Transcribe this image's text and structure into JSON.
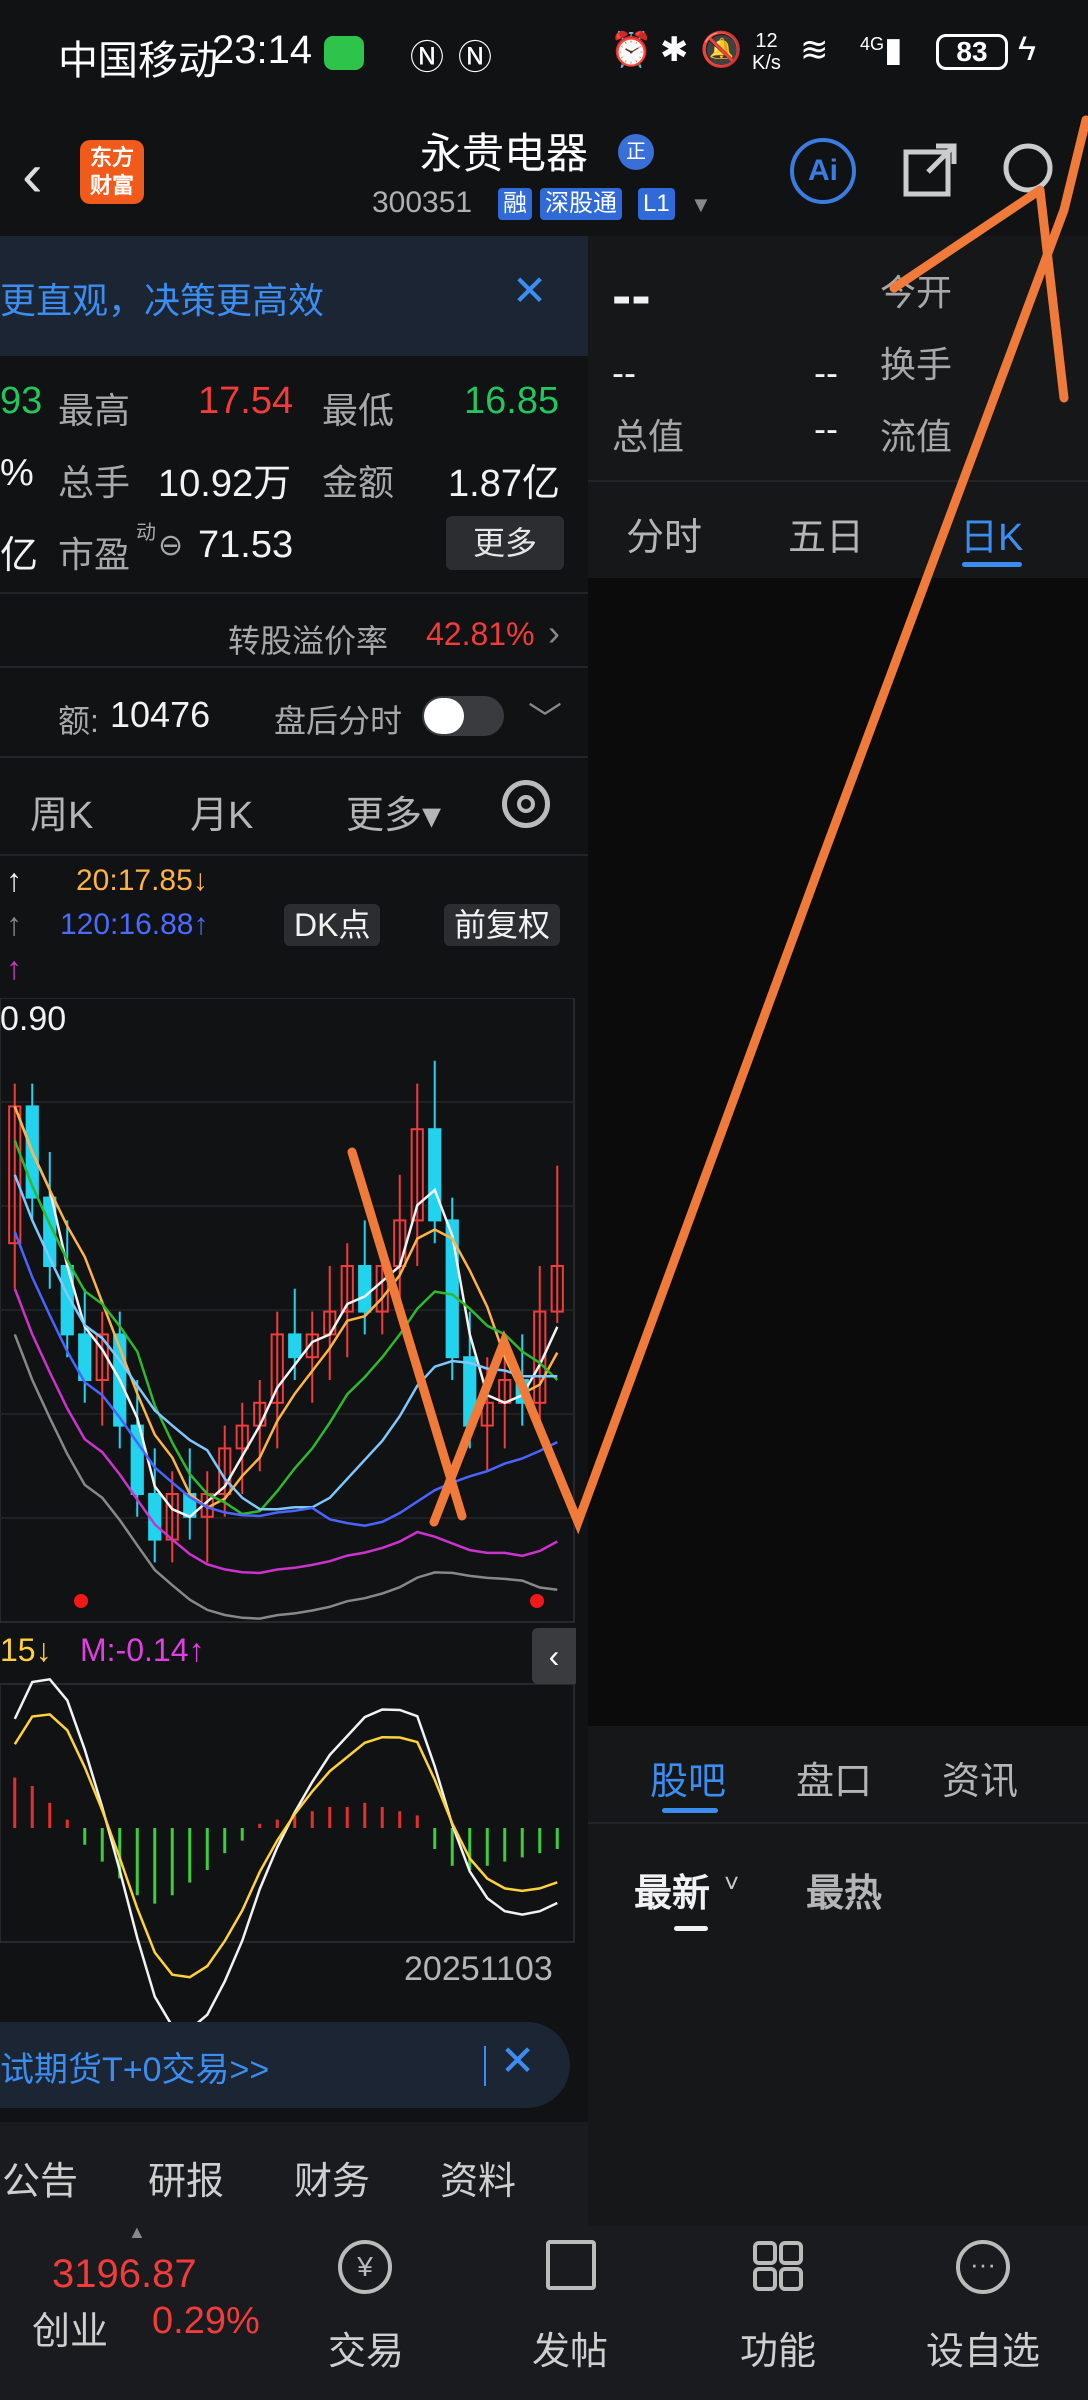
{
  "status_bar": {
    "carrier": "中国移动",
    "time": "23:14",
    "net_speed_top": "12",
    "net_speed_bottom": "K/s",
    "network": "4G",
    "battery": "83"
  },
  "header": {
    "title": "永贵电器",
    "title_badge": "正",
    "code": "300351",
    "tags": [
      "融",
      "深股通",
      "L1"
    ],
    "logo_line1": "东方",
    "logo_line2": "财富",
    "ai_label": "Ai"
  },
  "banner": {
    "text": "更直观，决策更高效"
  },
  "quotes": {
    "row1": {
      "left_val": "93",
      "high_label": "最高",
      "high_val": "17.54",
      "low_label": "最低",
      "low_val": "16.85"
    },
    "row2": {
      "left_val": "%",
      "vol_label": "总手",
      "vol_val": "10.92万",
      "amt_label": "金额",
      "amt_val": "1.87亿"
    },
    "row3": {
      "left_val": "亿",
      "pe_label": "市盈",
      "pe_sup": "动",
      "pe_val": "71.53",
      "more_label": "更多"
    }
  },
  "premium": {
    "label": "转股溢价率",
    "value": "42.81%"
  },
  "after_hours": {
    "amount_label": "额:",
    "amount_value": "10476",
    "toggle_label": "盘后分时"
  },
  "kline_tabs": {
    "week": "周K",
    "month": "月K",
    "more": "更多▾"
  },
  "ma_legend": {
    "ma20": "20:17.85↓",
    "ma120": "120:16.88↑",
    "dk_label": "DK点",
    "adjust_label": "前复权",
    "left_arrows": [
      "↑",
      "↑",
      "↑"
    ]
  },
  "chart_labels": {
    "price_high": "0.90",
    "macd_left": "15↓",
    "macd_m": "M:-0.14↑",
    "date": "20251103"
  },
  "ad": {
    "text": "试期货T+0交易>>"
  },
  "bottom_tabs": [
    "公告",
    "研报",
    "财务",
    "资料"
  ],
  "right_panel": {
    "price": "--",
    "change1": "--",
    "change2": "--",
    "open_label": "今开",
    "turnover_label": "换手",
    "cap_label": "总值",
    "cap_val": "--",
    "float_label": "流值",
    "float_val": "--",
    "tabs": [
      "分时",
      "五日",
      "日K"
    ],
    "forum_tabs": [
      "股吧",
      "盘口",
      "资讯"
    ],
    "sort_tabs": [
      "最新",
      "最热"
    ]
  },
  "nav": {
    "index_value": "3196.87",
    "index_name": "创业",
    "index_change": "0.29%",
    "items": [
      "交易",
      "发帖",
      "功能",
      "设自选"
    ]
  },
  "chart_data": {
    "type": "candlestick",
    "title": "",
    "price_high_label": 0.9,
    "candles": [
      [
        17.2,
        17.9,
        17.0,
        17.8
      ],
      [
        17.8,
        17.9,
        17.3,
        17.4
      ],
      [
        17.4,
        17.6,
        17.0,
        17.1
      ],
      [
        17.1,
        17.3,
        16.7,
        16.8
      ],
      [
        16.8,
        17.0,
        16.5,
        16.6
      ],
      [
        16.6,
        16.9,
        16.4,
        16.8
      ],
      [
        16.8,
        16.9,
        16.3,
        16.4
      ],
      [
        16.4,
        16.6,
        16.0,
        16.1
      ],
      [
        16.1,
        16.3,
        15.8,
        15.9
      ],
      [
        15.9,
        16.2,
        15.8,
        16.1
      ],
      [
        16.1,
        16.3,
        15.9,
        16.0
      ],
      [
        16.0,
        16.2,
        15.8,
        16.1
      ],
      [
        16.1,
        16.4,
        16.0,
        16.3
      ],
      [
        16.3,
        16.5,
        16.1,
        16.4
      ],
      [
        16.4,
        16.6,
        16.2,
        16.5
      ],
      [
        16.5,
        16.9,
        16.3,
        16.8
      ],
      [
        16.8,
        17.0,
        16.6,
        16.7
      ],
      [
        16.7,
        16.9,
        16.5,
        16.8
      ],
      [
        16.8,
        17.1,
        16.6,
        16.9
      ],
      [
        16.9,
        17.2,
        16.7,
        17.1
      ],
      [
        17.1,
        17.3,
        16.8,
        16.9
      ],
      [
        16.9,
        17.2,
        16.8,
        17.1
      ],
      [
        17.1,
        17.5,
        16.9,
        17.3
      ],
      [
        17.3,
        17.9,
        17.1,
        17.7
      ],
      [
        17.7,
        18.0,
        17.2,
        17.3
      ],
      [
        17.3,
        17.4,
        16.6,
        16.7
      ],
      [
        16.7,
        16.9,
        16.3,
        16.4
      ],
      [
        16.4,
        16.7,
        16.2,
        16.5
      ],
      [
        16.5,
        16.8,
        16.3,
        16.6
      ],
      [
        16.6,
        16.8,
        16.4,
        16.5
      ],
      [
        16.5,
        17.1,
        16.4,
        16.9
      ],
      [
        16.9,
        17.54,
        16.85,
        17.1
      ]
    ],
    "macd_hist": [
      0.12,
      0.1,
      0.06,
      0.02,
      -0.04,
      -0.08,
      -0.12,
      -0.16,
      -0.18,
      -0.16,
      -0.13,
      -0.1,
      -0.06,
      -0.03,
      0.01,
      0.02,
      0.03,
      0.04,
      0.05,
      0.05,
      0.06,
      0.05,
      0.04,
      0.03,
      -0.05,
      -0.09,
      -0.1,
      -0.09,
      -0.08,
      -0.07,
      -0.06,
      -0.05
    ],
    "ma_colors": [
      "#f2f2f2",
      "#ffb347",
      "#2db82d",
      "#7ec8ff",
      "#4b63ff",
      "#cc33cc",
      "#888888"
    ]
  }
}
